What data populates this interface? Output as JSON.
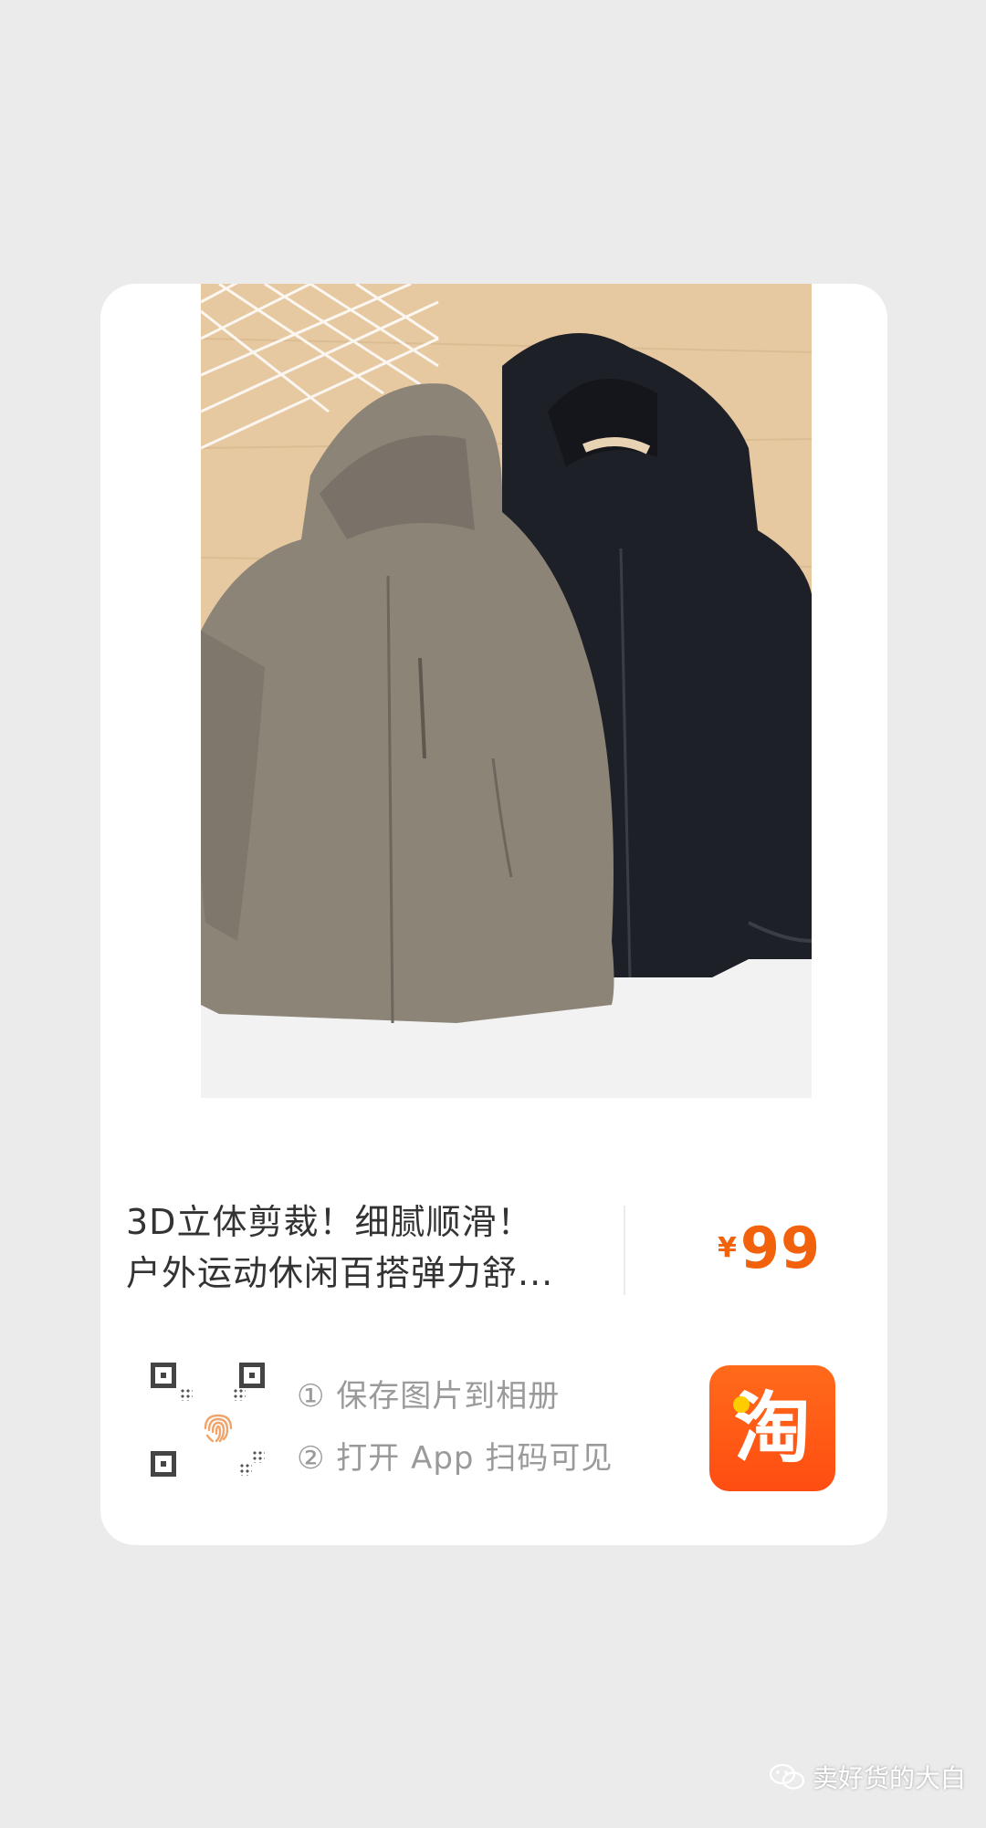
{
  "product": {
    "title_line1": "3D立体剪裁！细腻顺滑！",
    "title_line2": "户外运动休闲百搭弹力舒...",
    "price_currency": "¥",
    "price_amount": "99",
    "image_alt": "Two hooded zip-up jackets on hangers, taupe and black",
    "price_color": "#f2620c"
  },
  "scan": {
    "step1": "① 保存图片到相册",
    "step2": "② 打开 App 扫码可见"
  },
  "app_badge": {
    "glyph": "淘",
    "icon": "taobao-app-icon",
    "color": "#ff5a14"
  },
  "watermark": {
    "icon": "wechat-icon",
    "text": "卖好货的大白"
  }
}
